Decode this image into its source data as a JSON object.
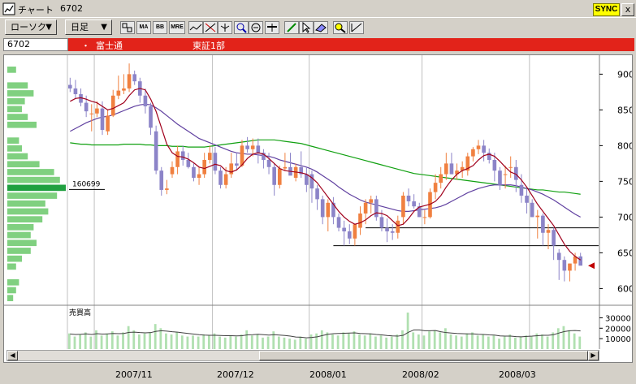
{
  "window": {
    "title": "チャート",
    "code": "6702",
    "sync_label": "SYNC",
    "close_label": "x"
  },
  "toolbar": {
    "period_label": "ローソク",
    "interval_label": "日足",
    "icons": [
      "compare-icon",
      "ma-icon",
      "bb-icon",
      "mre-icon",
      "trend-icon",
      "cross-icon",
      "fork-icon",
      "zoom-icon",
      "search-icon",
      "horizontal-line-icon",
      "pencil-icon",
      "pointer-icon",
      "eraser-icon",
      "magnify-icon",
      "fibonacci-icon"
    ],
    "ma_label": "MA",
    "bb_label": "BB",
    "mre_label": "MRE"
  },
  "info": {
    "code": "6702",
    "dot": "・",
    "name": "富士通",
    "market": "東証1部"
  },
  "price_axis": {
    "ticks": [
      "900",
      "850",
      "800",
      "750",
      "700",
      "650",
      "600"
    ],
    "values": [
      900,
      850,
      800,
      750,
      700,
      650,
      600
    ],
    "ylim": [
      580,
      922
    ]
  },
  "volume_profile_label": "160699",
  "volume_panel": {
    "label": "売買高",
    "ticks": [
      "30000",
      "20000",
      "10000"
    ],
    "values": [
      30000,
      20000,
      10000
    ]
  },
  "x_axis": {
    "labels": [
      "2007/11",
      "2007/12",
      "2008/01",
      "2008/02",
      "2008/03"
    ]
  },
  "colors": {
    "up": "#f08040",
    "down": "#8c84c8",
    "ma_short": "#a0001c",
    "ma_mid": "#6040a0",
    "ma_long": "#10a010",
    "volume": "#b0e0b0",
    "volume_line": "#404040",
    "infobar": "#e2231a",
    "grid": "#c0c0c0"
  },
  "chart_data": {
    "type": "candlestick",
    "x": [
      "10/25",
      "10/26",
      "10/29",
      "10/30",
      "10/31",
      "11/01",
      "11/02",
      "11/05",
      "11/06",
      "11/07",
      "11/08",
      "11/09",
      "11/12",
      "11/13",
      "11/14",
      "11/15",
      "11/16",
      "11/19",
      "11/20",
      "11/21",
      "11/22",
      "11/26",
      "11/27",
      "11/28",
      "11/29",
      "11/30",
      "12/03",
      "12/04",
      "12/05",
      "12/06",
      "12/07",
      "12/10",
      "12/11",
      "12/12",
      "12/13",
      "12/14",
      "12/17",
      "12/18",
      "12/19",
      "12/20",
      "12/21",
      "12/25",
      "12/26",
      "12/27",
      "12/28",
      "01/04",
      "01/07",
      "01/08",
      "01/09",
      "01/10",
      "01/11",
      "01/15",
      "01/16",
      "01/17",
      "01/18",
      "01/21",
      "01/22",
      "01/23",
      "01/24",
      "01/25",
      "01/28",
      "01/29",
      "01/30",
      "01/31",
      "02/01",
      "02/04",
      "02/05",
      "02/06",
      "02/07",
      "02/08",
      "02/12",
      "02/13",
      "02/14",
      "02/15",
      "02/18",
      "02/19",
      "02/20",
      "02/21",
      "02/22",
      "02/25",
      "02/26",
      "02/27",
      "02/28",
      "02/29",
      "03/03",
      "03/04",
      "03/05",
      "03/06",
      "03/07",
      "03/10",
      "03/11",
      "03/12",
      "03/13",
      "03/14",
      "03/17",
      "03/18"
    ],
    "open": [
      885,
      880,
      872,
      860,
      845,
      845,
      852,
      820,
      842,
      870,
      877,
      880,
      900,
      890,
      870,
      855,
      820,
      765,
      738,
      760,
      770,
      792,
      780,
      770,
      755,
      760,
      780,
      790,
      765,
      745,
      760,
      775,
      772,
      800,
      795,
      800,
      790,
      780,
      770,
      745,
      768,
      770,
      755,
      770,
      760,
      760,
      740,
      725,
      700,
      720,
      700,
      685,
      680,
      670,
      685,
      705,
      720,
      725,
      700,
      685,
      680,
      678,
      700,
      730,
      722,
      715,
      700,
      700,
      735,
      748,
      760,
      775,
      760,
      765,
      765,
      785,
      795,
      800,
      790,
      780,
      765,
      760,
      770,
      770,
      745,
      730,
      720,
      700,
      702,
      678,
      682,
      650,
      640,
      625,
      635,
      645
    ],
    "high": [
      895,
      892,
      880,
      870,
      858,
      862,
      862,
      850,
      878,
      898,
      900,
      915,
      905,
      895,
      880,
      860,
      828,
      770,
      752,
      778,
      800,
      800,
      790,
      775,
      770,
      790,
      800,
      798,
      770,
      770,
      790,
      790,
      808,
      812,
      810,
      810,
      795,
      790,
      775,
      772,
      790,
      790,
      775,
      792,
      770,
      765,
      745,
      730,
      725,
      728,
      705,
      695,
      690,
      685,
      715,
      725,
      730,
      730,
      710,
      698,
      690,
      702,
      735,
      740,
      732,
      720,
      710,
      740,
      760,
      770,
      790,
      790,
      775,
      778,
      790,
      798,
      808,
      808,
      796,
      790,
      770,
      772,
      785,
      780,
      760,
      740,
      725,
      710,
      705,
      690,
      685,
      655,
      645,
      635,
      650,
      650
    ],
    "low": [
      875,
      865,
      855,
      840,
      820,
      840,
      815,
      815,
      840,
      865,
      872,
      875,
      885,
      860,
      845,
      815,
      760,
      730,
      732,
      755,
      760,
      772,
      768,
      750,
      745,
      755,
      775,
      760,
      740,
      740,
      755,
      765,
      770,
      790,
      785,
      775,
      768,
      760,
      730,
      740,
      765,
      765,
      750,
      755,
      735,
      720,
      710,
      690,
      680,
      690,
      680,
      660,
      662,
      660,
      675,
      690,
      705,
      695,
      680,
      665,
      668,
      670,
      690,
      715,
      712,
      700,
      690,
      698,
      725,
      740,
      752,
      760,
      752,
      755,
      758,
      778,
      788,
      778,
      775,
      750,
      738,
      740,
      755,
      735,
      720,
      705,
      700,
      670,
      660,
      655,
      640,
      612,
      610,
      610,
      625,
      635
    ],
    "close": [
      880,
      872,
      860,
      848,
      845,
      852,
      822,
      842,
      870,
      877,
      880,
      900,
      890,
      870,
      855,
      825,
      765,
      738,
      740,
      770,
      792,
      780,
      770,
      755,
      760,
      780,
      790,
      765,
      745,
      760,
      775,
      772,
      800,
      795,
      800,
      790,
      780,
      770,
      745,
      768,
      770,
      758,
      770,
      760,
      745,
      740,
      725,
      700,
      720,
      700,
      685,
      680,
      670,
      690,
      705,
      720,
      725,
      700,
      685,
      680,
      678,
      695,
      730,
      722,
      715,
      700,
      700,
      735,
      748,
      760,
      775,
      760,
      765,
      770,
      785,
      795,
      800,
      790,
      780,
      765,
      745,
      760,
      770,
      752,
      730,
      720,
      700,
      702,
      678,
      682,
      660,
      640,
      625,
      635,
      645,
      632
    ],
    "ma_short": [
      862,
      866,
      867,
      865,
      862,
      860,
      855,
      850,
      852,
      856,
      860,
      870,
      878,
      880,
      878,
      865,
      848,
      825,
      802,
      790,
      785,
      784,
      781,
      776,
      770,
      768,
      771,
      774,
      772,
      765,
      763,
      766,
      773,
      782,
      788,
      790,
      788,
      782,
      775,
      768,
      765,
      764,
      763,
      762,
      760,
      755,
      748,
      738,
      728,
      718,
      708,
      700,
      694,
      690,
      692,
      696,
      702,
      706,
      705,
      702,
      695,
      688,
      690,
      698,
      708,
      714,
      716,
      718,
      722,
      730,
      742,
      752,
      760,
      765,
      768,
      772,
      780,
      786,
      788,
      785,
      778,
      770,
      763,
      760,
      752,
      742,
      730,
      718,
      708,
      698,
      688,
      675,
      662,
      652,
      645,
      640
    ],
    "ma_mid": [
      820,
      824,
      828,
      832,
      835,
      838,
      840,
      841,
      843,
      846,
      849,
      852,
      855,
      857,
      858,
      857,
      853,
      848,
      842,
      836,
      830,
      825,
      820,
      815,
      810,
      807,
      804,
      801,
      798,
      795,
      792,
      790,
      789,
      788,
      788,
      787,
      786,
      785,
      783,
      780,
      778,
      776,
      774,
      772,
      770,
      767,
      763,
      758,
      753,
      748,
      742,
      737,
      732,
      728,
      724,
      721,
      719,
      717,
      715,
      713,
      711,
      709,
      708,
      708,
      709,
      710,
      711,
      712,
      713,
      715,
      718,
      722,
      726,
      730,
      734,
      737,
      740,
      742,
      744,
      745,
      745,
      745,
      745,
      744,
      742,
      740,
      738,
      735,
      732,
      728,
      724,
      719,
      714,
      709,
      704,
      700
    ],
    "ma_long": [
      804,
      803,
      802,
      802,
      801,
      801,
      801,
      801,
      801,
      801,
      802,
      802,
      802,
      802,
      801,
      801,
      800,
      800,
      800,
      799,
      799,
      799,
      798,
      798,
      798,
      798,
      799,
      800,
      801,
      802,
      803,
      804,
      805,
      806,
      807,
      808,
      808,
      808,
      808,
      807,
      806,
      805,
      804,
      803,
      801,
      799,
      797,
      795,
      793,
      791,
      789,
      787,
      785,
      783,
      781,
      779,
      777,
      775,
      773,
      771,
      769,
      767,
      765,
      763,
      761,
      760,
      759,
      758,
      757,
      756,
      755,
      754,
      753,
      752,
      751,
      750,
      749,
      748,
      747,
      746,
      745,
      744,
      743,
      742,
      741,
      740,
      739,
      738,
      738,
      737,
      736,
      735,
      735,
      734,
      733,
      732
    ],
    "volume": [
      15000,
      12000,
      14000,
      16000,
      12000,
      18000,
      13000,
      15000,
      17000,
      13000,
      16000,
      22000,
      18000,
      14000,
      15000,
      16000,
      24000,
      20000,
      15000,
      14000,
      16000,
      13000,
      12000,
      13000,
      12000,
      14000,
      13000,
      15000,
      12000,
      11000,
      13000,
      12000,
      14000,
      18000,
      13000,
      14000,
      11000,
      12000,
      17000,
      12000,
      11000,
      10000,
      9000,
      12000,
      10000,
      14000,
      15000,
      18000,
      16000,
      14000,
      13000,
      16000,
      15000,
      17000,
      14000,
      13000,
      15000,
      12000,
      13000,
      11000,
      12000,
      14000,
      18000,
      35000,
      16000,
      14000,
      13000,
      17000,
      18000,
      16000,
      20000,
      14000,
      13000,
      12000,
      15000,
      16000,
      13000,
      14000,
      12000,
      13000,
      10000,
      12000,
      14000,
      11000,
      12000,
      13000,
      12000,
      15000,
      14000,
      12000,
      16000,
      20000,
      22000,
      18000,
      15000,
      12000
    ],
    "volume_ma": [
      14500,
      14000,
      14200,
      14600,
      14000,
      14800,
      14400,
      14600,
      15000,
      14800,
      15000,
      16000,
      16200,
      15800,
      15600,
      15800,
      17000,
      17600,
      17200,
      16600,
      16200,
      15600,
      15000,
      14400,
      13800,
      13400,
      13200,
      13200,
      13000,
      12800,
      12800,
      12600,
      12800,
      13600,
      13800,
      14200,
      13800,
      13400,
      13800,
      13400,
      13000,
      12400,
      11600,
      11400,
      10800,
      11200,
      11800,
      13000,
      14200,
      14800,
      15000,
      15200,
      15400,
      15600,
      15000,
      14800,
      14600,
      14000,
      13600,
      13000,
      12600,
      12400,
      13200,
      16200,
      18400,
      18400,
      17600,
      17600,
      17800,
      16600,
      15800,
      15400,
      15000,
      14800,
      14600,
      14600,
      14200,
      14000,
      13600,
      13400,
      12600,
      12400,
      12400,
      12000,
      11800,
      12200,
      12400,
      12800,
      13200,
      13200,
      13800,
      15400,
      16800,
      17600,
      17800,
      17400
    ],
    "price_lines": [
      685,
      660
    ],
    "ylim": [
      580,
      922
    ]
  }
}
